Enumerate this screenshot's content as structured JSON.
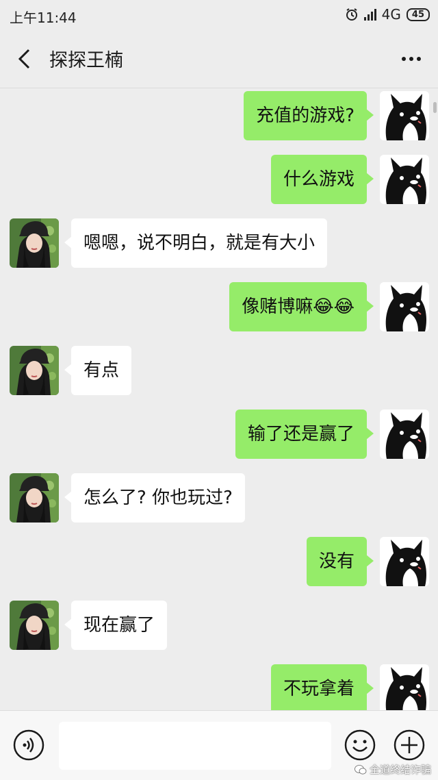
{
  "status_bar": {
    "time": "上午11:44",
    "network": "4G",
    "battery": "45"
  },
  "header": {
    "title": "探探王楠"
  },
  "messages": [
    {
      "side": "out",
      "text": "充值的游戏?"
    },
    {
      "side": "out",
      "text": "什么游戏"
    },
    {
      "side": "in",
      "text": "嗯嗯，说不明白，就是有大小"
    },
    {
      "side": "out",
      "text": "像赌博嘛😂😂"
    },
    {
      "side": "in",
      "text": "有点"
    },
    {
      "side": "out",
      "text": "输了还是赢了"
    },
    {
      "side": "in",
      "text": "怎么了? 你也玩过?"
    },
    {
      "side": "out",
      "text": "没有"
    },
    {
      "side": "in",
      "text": "现在赢了"
    },
    {
      "side": "out",
      "text": "不玩拿着"
    }
  ],
  "watermark": "全道终结诈骗",
  "colors": {
    "outgoing_bubble": "#95ec69",
    "incoming_bubble": "#ffffff",
    "background": "#ededed"
  }
}
